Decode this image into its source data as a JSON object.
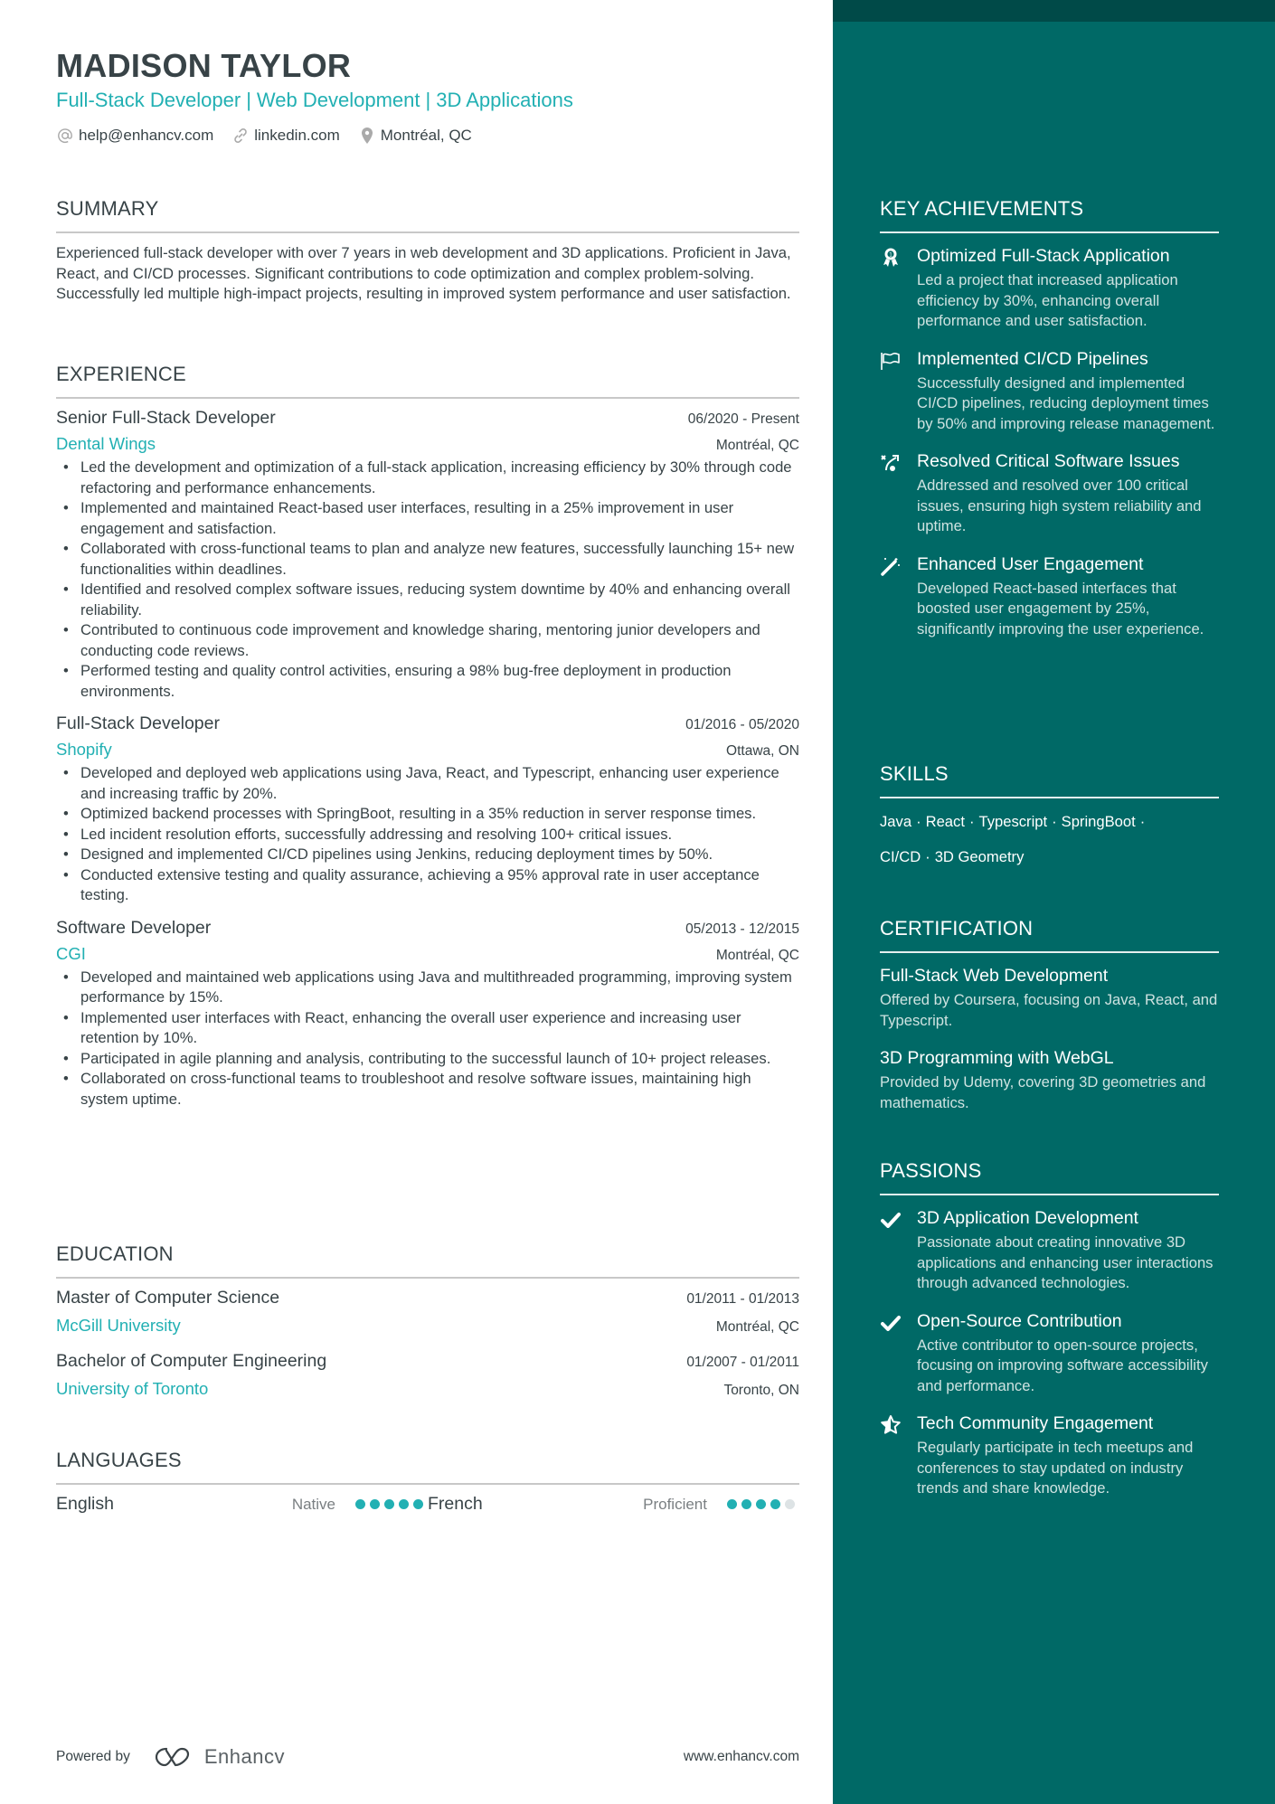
{
  "header": {
    "name": "MADISON TAYLOR",
    "subtitle_parts": [
      "Full-Stack Developer",
      "Web Development",
      "3D Applications"
    ],
    "subtitle_separator": "|",
    "contacts": [
      {
        "icon": "at-icon",
        "text": "help@enhancv.com"
      },
      {
        "icon": "link-icon",
        "text": "linkedin.com"
      },
      {
        "icon": "location-pin-icon",
        "text": "Montréal, QC"
      }
    ]
  },
  "summary": {
    "title": "SUMMARY",
    "text": "Experienced full-stack developer with over 7 years in web development and 3D applications. Proficient in Java, React, and CI/CD processes. Significant contributions to code optimization and complex problem-solving. Successfully led multiple high-impact projects, resulting in improved system performance and user satisfaction."
  },
  "experience": {
    "title": "EXPERIENCE",
    "items": [
      {
        "role": "Senior Full-Stack Developer",
        "dates": "06/2020 - Present",
        "company": "Dental Wings",
        "location": "Montréal, QC",
        "bullets": [
          "Led the development and optimization of a full-stack application, increasing efficiency by 30% through code refactoring and performance enhancements.",
          "Implemented and maintained React-based user interfaces, resulting in a 25% improvement in user engagement and satisfaction.",
          "Collaborated with cross-functional teams to plan and analyze new features, successfully launching 15+ new functionalities within deadlines.",
          "Identified and resolved complex software issues, reducing system downtime by 40% and enhancing overall reliability.",
          "Contributed to continuous code improvement and knowledge sharing, mentoring junior developers and conducting code reviews.",
          "Performed testing and quality control activities, ensuring a 98% bug-free deployment in production environments."
        ]
      },
      {
        "role": "Full-Stack Developer",
        "dates": "01/2016 - 05/2020",
        "company": "Shopify",
        "location": "Ottawa, ON",
        "bullets": [
          "Developed and deployed web applications using Java, React, and Typescript, enhancing user experience and increasing traffic by 20%.",
          "Optimized backend processes with SpringBoot, resulting in a 35% reduction in server response times.",
          "Led incident resolution efforts, successfully addressing and resolving 100+ critical issues.",
          "Designed and implemented CI/CD pipelines using Jenkins, reducing deployment times by 50%.",
          "Conducted extensive testing and quality assurance, achieving a 95% approval rate in user acceptance testing."
        ]
      },
      {
        "role": "Software Developer",
        "dates": "05/2013 - 12/2015",
        "company": "CGI",
        "location": "Montréal, QC",
        "bullets": [
          "Developed and maintained web applications using Java and multithreaded programming, improving system performance by 15%.",
          "Implemented user interfaces with React, enhancing the overall user experience and increasing user retention by 10%.",
          "Participated in agile planning and analysis, contributing to the successful launch of 10+ project releases.",
          "Collaborated on cross-functional teams to troubleshoot and resolve software issues, maintaining high system uptime."
        ]
      }
    ]
  },
  "education": {
    "title": "EDUCATION",
    "items": [
      {
        "degree": "Master of Computer Science",
        "dates": "01/2011 - 01/2013",
        "school": "McGill University",
        "location": "Montréal, QC"
      },
      {
        "degree": "Bachelor of Computer Engineering",
        "dates": "01/2007 - 01/2011",
        "school": "University of Toronto",
        "location": "Toronto, ON"
      }
    ]
  },
  "languages": {
    "title": "LANGUAGES",
    "items": [
      {
        "name": "English",
        "level": "Native",
        "rating": 5,
        "max": 5
      },
      {
        "name": "French",
        "level": "Proficient",
        "rating": 4,
        "max": 5
      }
    ]
  },
  "footer": {
    "powered_by": "Powered by",
    "brand": "Enhancv",
    "url": "www.enhancv.com"
  },
  "sidebar": {
    "achievements": {
      "title": "KEY ACHIEVEMENTS",
      "items": [
        {
          "icon": "award-ribbon-icon",
          "title": "Optimized Full-Stack Application",
          "desc": "Led a project that increased application efficiency by 30%, enhancing overall performance and user satisfaction."
        },
        {
          "icon": "flag-icon",
          "title": "Implemented CI/CD Pipelines",
          "desc": "Successfully designed and implemented CI/CD pipelines, reducing deployment times by 50% and improving release management."
        },
        {
          "icon": "path-route-icon",
          "title": "Resolved Critical Software Issues",
          "desc": "Addressed and resolved over 100 critical issues, ensuring high system reliability and uptime."
        },
        {
          "icon": "magic-wand-icon",
          "title": "Enhanced User Engagement",
          "desc": "Developed React-based interfaces that boosted user engagement by 25%, significantly improving the user experience."
        }
      ]
    },
    "skills": {
      "title": "SKILLS",
      "items": [
        "Java",
        "React",
        "Typescript",
        "SpringBoot",
        "CI/CD",
        "3D Geometry"
      ]
    },
    "certification": {
      "title": "CERTIFICATION",
      "items": [
        {
          "title": "Full-Stack Web Development",
          "desc": "Offered by Coursera, focusing on Java, React, and Typescript."
        },
        {
          "title": "3D Programming with WebGL",
          "desc": "Provided by Udemy, covering 3D geometries and mathematics."
        }
      ]
    },
    "passions": {
      "title": "PASSIONS",
      "items": [
        {
          "icon": "checkmark-icon",
          "title": "3D Application Development",
          "desc": "Passionate about creating innovative 3D applications and enhancing user interactions through advanced technologies."
        },
        {
          "icon": "checkmark-icon",
          "title": "Open-Source Contribution",
          "desc": "Active contributor to open-source projects, focusing on improving software accessibility and performance."
        },
        {
          "icon": "star-icon",
          "title": "Tech Community Engagement",
          "desc": "Regularly participate in tech meetups and conferences to stay updated on industry trends and share knowledge."
        }
      ]
    }
  },
  "colors": {
    "accent": "#22b0b3",
    "sidebar_bg": "#006966",
    "sidebar_topbar": "#004a48",
    "text": "#384347"
  }
}
